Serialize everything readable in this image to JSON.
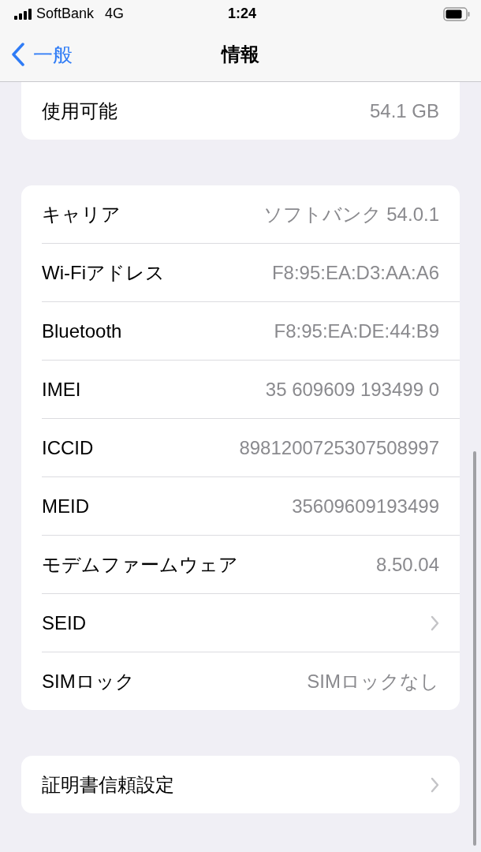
{
  "status_bar": {
    "carrier": "SoftBank",
    "network": "4G",
    "time": "1:24"
  },
  "nav_bar": {
    "back": "一般",
    "title": "情報"
  },
  "groups": [
    {
      "cut_top": true,
      "rows": [
        {
          "kind": "value",
          "label": "使用可能",
          "value": "54.1 GB"
        }
      ]
    },
    {
      "cut_top": false,
      "rows": [
        {
          "kind": "value",
          "label": "キャリア",
          "value": "ソフトバンク 54.0.1"
        },
        {
          "kind": "value",
          "label": "Wi-Fiアドレス",
          "value": "F8:95:EA:D3:AA:A6"
        },
        {
          "kind": "value",
          "label": "Bluetooth",
          "value": "F8:95:EA:DE:44:B9"
        },
        {
          "kind": "value",
          "label": "IMEI",
          "value": "35 609609 193499 0"
        },
        {
          "kind": "value",
          "label": "ICCID",
          "value": "8981200725307508997"
        },
        {
          "kind": "value",
          "label": "MEID",
          "value": "35609609193499"
        },
        {
          "kind": "value",
          "label": "モデムファームウェア",
          "value": "8.50.04"
        },
        {
          "kind": "link",
          "label": "SEID"
        },
        {
          "kind": "value",
          "label": "SIMロック",
          "value": "SIMロックなし"
        }
      ]
    },
    {
      "cut_top": false,
      "rows": [
        {
          "kind": "link",
          "label": "証明書信頼設定"
        }
      ]
    }
  ]
}
